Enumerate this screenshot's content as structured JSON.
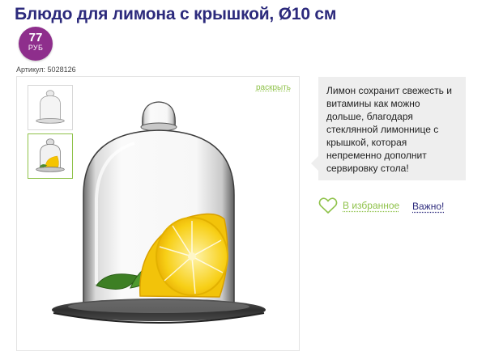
{
  "product": {
    "title": "Блюдо для лимона с крышкой, Ø10 см",
    "article": "Артикул: 5028126",
    "description": "Лимон сохранит свежесть и витамины как можно дольше, благодаря стеклянной лимоннице с крышкой, которая непременно дополнит сервировку стола!"
  },
  "price": {
    "amount": "77",
    "currency": "РУБ"
  },
  "gallery": {
    "expand_label": "раскрыть",
    "thumbnails": [
      {
        "name": "empty glass dome",
        "selected": false
      },
      {
        "name": "dome with lemon",
        "selected": true
      }
    ]
  },
  "actions": {
    "favorite_label": "В избранное",
    "important_label": "Важно!"
  },
  "colors": {
    "title": "#2c2a7c",
    "badge": "#8e2e8c",
    "accent_green": "#8fc24a",
    "description_bg": "#eeeeee"
  }
}
